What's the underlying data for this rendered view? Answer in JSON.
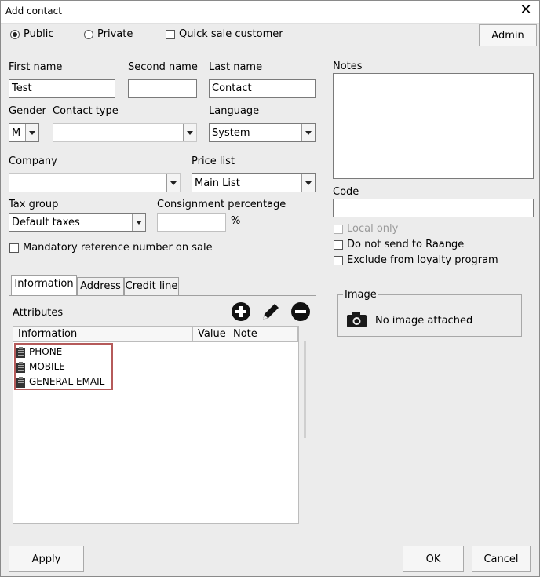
{
  "window": {
    "title": "Add contact"
  },
  "visibility": {
    "public_label": "Public",
    "private_label": "Private",
    "selected": "Public"
  },
  "quick_sale": {
    "label": "Quick sale customer"
  },
  "admin_button": "Admin",
  "fields": {
    "first_name": {
      "label": "First name",
      "value": "Test"
    },
    "second_name": {
      "label": "Second name",
      "value": ""
    },
    "last_name": {
      "label": "Last name",
      "value": "Contact"
    },
    "gender": {
      "label": "Gender",
      "value": "M"
    },
    "contact_type": {
      "label": "Contact type",
      "value": ""
    },
    "language": {
      "label": "Language",
      "value": "System"
    },
    "company": {
      "label": "Company",
      "value": ""
    },
    "price_list": {
      "label": "Price list",
      "value": "Main List"
    },
    "tax_group": {
      "label": "Tax group",
      "value": "Default taxes"
    },
    "consignment": {
      "label": "Consignment percentage",
      "value": "",
      "unit": "%"
    },
    "notes": {
      "label": "Notes",
      "value": ""
    },
    "code": {
      "label": "Code",
      "value": ""
    }
  },
  "mandatory_reference": {
    "label": "Mandatory reference number on sale"
  },
  "right_options": {
    "local_only": "Local only",
    "do_not_send": "Do not send to Raange",
    "exclude_loyalty": "Exclude from loyalty program"
  },
  "tabs": [
    "Information",
    "Address",
    "Credit line"
  ],
  "attributes": {
    "label": "Attributes",
    "columns": [
      "Information",
      "Value",
      "Note"
    ],
    "rows": [
      {
        "name": "PHONE"
      },
      {
        "name": "MOBILE"
      },
      {
        "name": "GENERAL EMAIL"
      }
    ]
  },
  "image": {
    "group_label": "Image",
    "status": "No image attached"
  },
  "buttons": {
    "apply": "Apply",
    "ok": "OK",
    "cancel": "Cancel"
  }
}
